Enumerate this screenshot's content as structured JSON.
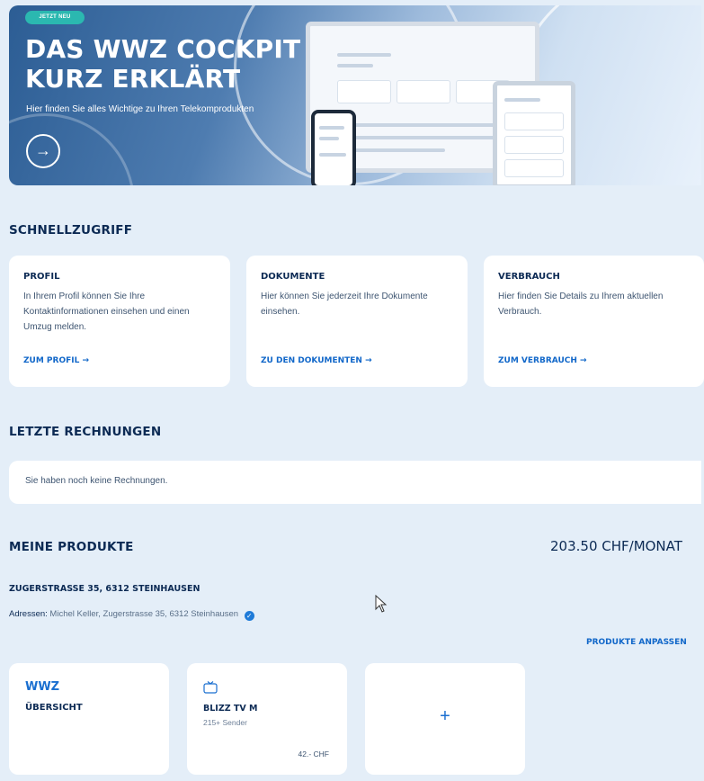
{
  "hero": {
    "badge": "JETZT NEU",
    "title_line1": "DAS WWZ COCKPIT",
    "title_line2": "KURZ ERKLÄRT",
    "subtitle": "Hier finden Sie alles Wichtige zu Ihren Telekomprodukten",
    "arrow": "→"
  },
  "quick_access": {
    "title": "SCHNELLZUGRIFF",
    "cards": [
      {
        "title": "PROFIL",
        "text": "In Ihrem Profil können Sie Ihre Kontaktinformationen einsehen und einen Umzug melden.",
        "link": "ZUM PROFIL →"
      },
      {
        "title": "DOKUMENTE",
        "text": "Hier können Sie jederzeit Ihre Dokumente einsehen.",
        "link": "ZU DEN DOKUMENTEN →"
      },
      {
        "title": "VERBRAUCH",
        "text": "Hier finden Sie Details zu Ihrem aktuellen Verbrauch.",
        "link": "ZUM VERBRAUCH →"
      }
    ]
  },
  "invoices": {
    "title": "LETZTE RECHNUNGEN",
    "empty_text": "Sie haben noch keine Rechnungen."
  },
  "products": {
    "title": "MEINE PRODUKTE",
    "total": "203.50 CHF/MONAT",
    "address_title": "ZUGERSTRASSE 35, 6312 STEINHAUSEN",
    "address_label": "Adressen:",
    "address_value": "Michel Keller, Zugerstrasse 35, 6312 Steinhausen",
    "adjust_link": "PRODUKTE ANPASSEN",
    "overview_card": {
      "brand": "WWZ",
      "label": "ÜBERSICHT"
    },
    "product_card": {
      "name": "BLIZZ TV M",
      "detail": "215+ Sender",
      "price": "42.- CHF"
    },
    "add_card": {
      "plus": "+"
    }
  },
  "colors": {
    "background": "#e4eef8",
    "navy": "#0c2a54",
    "link_blue": "#1167c9",
    "badge_teal": "#2bb8b0"
  },
  "icons": [
    "arrow-right-icon",
    "verified-check-icon",
    "tv-icon",
    "mouse-cursor-icon",
    "plus-icon"
  ]
}
